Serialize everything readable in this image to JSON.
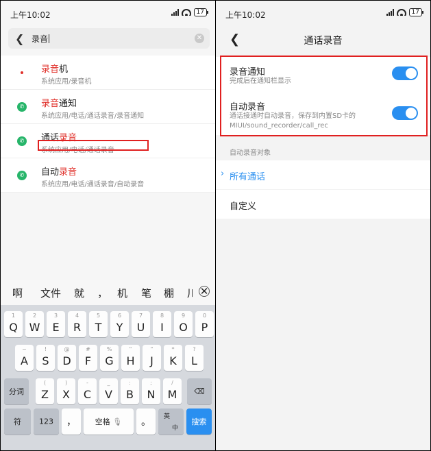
{
  "left": {
    "status": {
      "time": "上午10:02",
      "battery": "17"
    },
    "search": {
      "query": "录音",
      "clear_icon": "clear-icon",
      "back_icon": "back-arrow-icon"
    },
    "results": [
      {
        "highlight": "录音",
        "rest": "机",
        "path": "系统应用/录音机",
        "icon": "red-dot-icon"
      },
      {
        "highlight": "录音",
        "rest": "通知",
        "path": "系统应用/电话/通话录音/录音通知",
        "icon": "phone-icon"
      },
      {
        "prefix": "通话",
        "highlight": "录音",
        "path": "系统应用/电话/通话录音",
        "icon": "phone-icon"
      },
      {
        "prefix": "自动",
        "highlight": "录音",
        "path": "系统应用/电话/通话录音/自动录音",
        "icon": "phone-icon"
      }
    ],
    "candidates": [
      "啊",
      "文件",
      "就",
      "，",
      "机",
      "笔",
      "棚",
      "川"
    ],
    "keyboard": {
      "row1": [
        {
          "k": "Q",
          "s": "1"
        },
        {
          "k": "W",
          "s": "2"
        },
        {
          "k": "E",
          "s": "3"
        },
        {
          "k": "R",
          "s": "4"
        },
        {
          "k": "T",
          "s": "5"
        },
        {
          "k": "Y",
          "s": "6"
        },
        {
          "k": "U",
          "s": "7"
        },
        {
          "k": "I",
          "s": "8"
        },
        {
          "k": "O",
          "s": "9"
        },
        {
          "k": "P",
          "s": "0"
        }
      ],
      "row2": [
        {
          "k": "A",
          "s": "~"
        },
        {
          "k": "S",
          "s": "!"
        },
        {
          "k": "D",
          "s": "@"
        },
        {
          "k": "F",
          "s": "#"
        },
        {
          "k": "G",
          "s": "%"
        },
        {
          "k": "H",
          "s": "\""
        },
        {
          "k": "J",
          "s": "\""
        },
        {
          "k": "K",
          "s": "*"
        },
        {
          "k": "L",
          "s": "?"
        }
      ],
      "row3": [
        {
          "k": "Z",
          "s": "("
        },
        {
          "k": "X",
          "s": ")"
        },
        {
          "k": "C",
          "s": "-"
        },
        {
          "k": "V",
          "s": "_"
        },
        {
          "k": "B",
          "s": ":"
        },
        {
          "k": "N",
          "s": ";"
        },
        {
          "k": "M",
          "s": "/"
        }
      ],
      "split_label": "分词",
      "delete_icon": "backspace-icon",
      "symbol_label": "符",
      "num_label": "123",
      "comma_label": "，",
      "space_label": "空格",
      "mic_icon": "mic-icon",
      "period_label": "。",
      "lang_top": "英",
      "lang_bottom": "中",
      "search_label": "搜索"
    }
  },
  "right": {
    "status": {
      "time": "上午10:02",
      "battery": "17"
    },
    "header": {
      "title": "通话录音",
      "back_icon": "back-arrow-icon"
    },
    "settings": [
      {
        "title": "录音通知",
        "desc": "完成后在通知栏显示",
        "enabled": true
      },
      {
        "title": "自动录音",
        "desc": "通话接通时自动录音，保存到内置SD卡的MIUI/sound_recorder/call_rec",
        "enabled": true
      }
    ],
    "section_label": "自动录音对象",
    "options": [
      {
        "label": "所有通话",
        "selected": true
      },
      {
        "label": "自定义",
        "selected": false
      }
    ]
  },
  "colors": {
    "accent": "#2a8ff0",
    "highlight": "#e0302a",
    "annotation": "#e02020",
    "phone_green": "#27b56a"
  }
}
